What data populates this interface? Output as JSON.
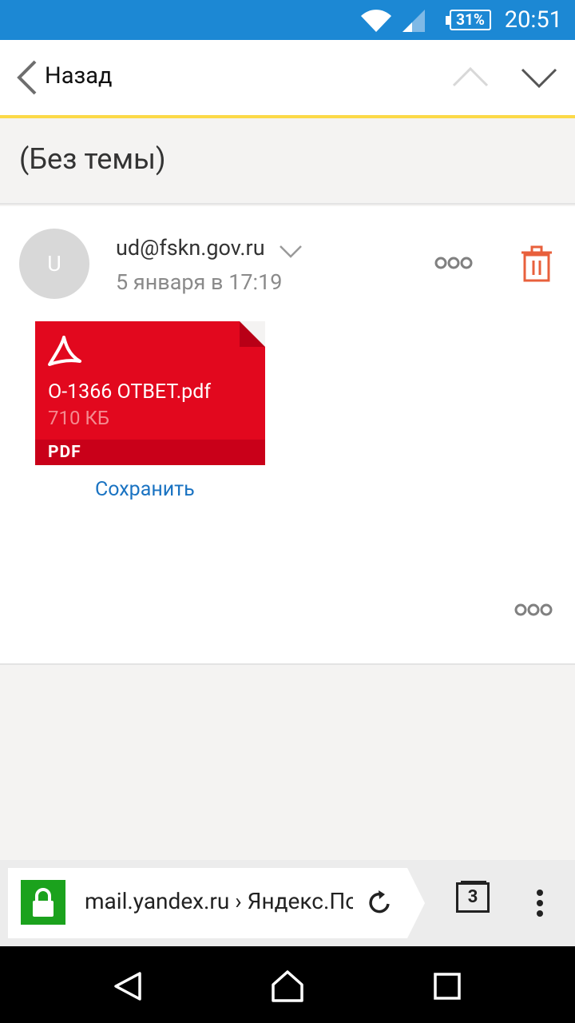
{
  "status_bar": {
    "battery": "31%",
    "time": "20:51"
  },
  "top_nav": {
    "back_label": "Назад"
  },
  "subject": "(Без темы)",
  "message": {
    "avatar_letter": "U",
    "sender": "ud@fskn.gov.ru",
    "date": "5 января в 17:19",
    "attachment": {
      "file_name": "О-1366 ОТВЕТ.pdf",
      "size": "710 КБ",
      "type_label": "PDF",
      "save_label": "Сохранить"
    }
  },
  "browser_bar": {
    "url": "mail.yandex.ru › Яндекс.Почта",
    "tab_count": "3"
  },
  "colors": {
    "status_bar": "#1c88d4",
    "accent_yellow": "#fcd947",
    "pdf_red": "#e2081e",
    "link_blue": "#1a73c2",
    "delete_orange": "#e8603c",
    "lock_green": "#1ba21d"
  },
  "icons": [
    "wifi-icon",
    "signal-icon",
    "battery-icon",
    "back-chevron-icon",
    "up-chevron-icon",
    "down-chevron-icon",
    "expand-chevron-icon",
    "more-icon",
    "trash-icon",
    "acrobat-icon",
    "lock-icon",
    "reload-icon",
    "tabs-icon",
    "menu-icon",
    "nav-back-icon",
    "nav-home-icon",
    "nav-recents-icon"
  ]
}
